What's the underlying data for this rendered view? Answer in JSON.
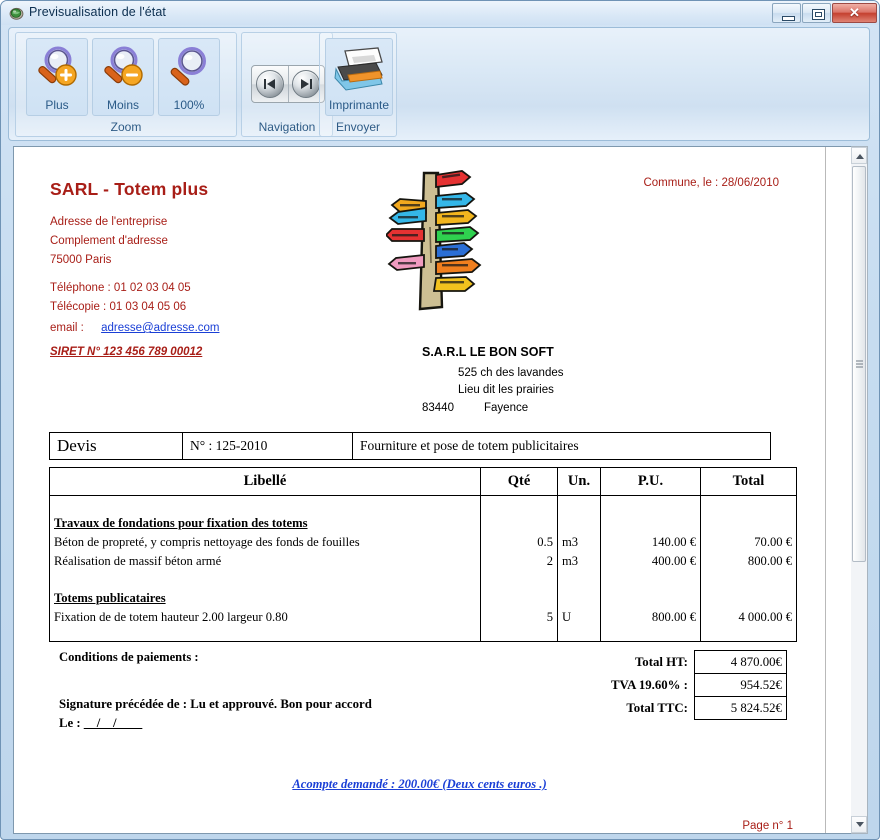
{
  "window": {
    "title": "Previsualisation de l'état",
    "icon": "preview-globe-icon",
    "buttons": {
      "minimize": "minimize-icon",
      "restore": "restore-icon",
      "close": "✕"
    }
  },
  "ribbon": {
    "groups": [
      {
        "name": "Zoom",
        "label": "Zoom",
        "buttons": [
          {
            "label": "Plus",
            "icon": "zoom-in-icon"
          },
          {
            "label": "Moins",
            "icon": "zoom-out-icon"
          },
          {
            "label": "100%",
            "icon": "zoom-100-icon"
          }
        ]
      },
      {
        "name": "Navigation",
        "label": "Navigation",
        "buttons": [
          {
            "label": "",
            "icon": "previous-page-icon"
          },
          {
            "label": "",
            "icon": "next-page-icon"
          }
        ]
      },
      {
        "name": "Envoyer",
        "label": "Envoyer",
        "buttons": [
          {
            "label": "Imprimante",
            "icon": "printer-icon"
          }
        ]
      }
    ]
  },
  "document": {
    "sender": {
      "company": "SARL - Totem plus",
      "address1": "Adresse de l'entreprise",
      "address2": "Complement d'adresse",
      "city": "75000  Paris",
      "phone": "Téléphone : 01 02 03 04 05",
      "fax": "Télécopie   : 01 03 04 05 06",
      "email_label": "email :",
      "email": "adresse@adresse.com",
      "siret": "SIRET N° 123 456 789 00012"
    },
    "date_line": "Commune, le :  28/06/2010",
    "logo": "totem-signpost-image",
    "client": {
      "name": "S.A.R.L LE BON SOFT",
      "address1": "525 ch des lavandes",
      "address2": "Lieu dit les prairies",
      "postcode": "83440",
      "city": "Fayence"
    },
    "doc_header": {
      "type": "Devis",
      "number": "N° : 125-2010",
      "subject": "Fourniture et pose de totem publicitaires"
    },
    "table": {
      "columns": [
        "Libellé",
        "Qté",
        "Un.",
        "P.U.",
        "Total"
      ],
      "rows": [
        {
          "kind": "section",
          "label": "Travaux de fondations pour fixation des totems",
          "qty": "",
          "unit": "",
          "pu": "",
          "total": ""
        },
        {
          "kind": "item",
          "label": "Béton de propreté, y compris nettoyage des fonds de fouilles",
          "qty": "0.5",
          "unit": "m3",
          "pu": "140.00 €",
          "total": "70.00 €"
        },
        {
          "kind": "item",
          "label": "Réalisation de massif béton armé",
          "qty": "2",
          "unit": "m3",
          "pu": "400.00 €",
          "total": "800.00 €"
        },
        {
          "kind": "blank",
          "label": "",
          "qty": "",
          "unit": "",
          "pu": "",
          "total": ""
        },
        {
          "kind": "section",
          "label": "Totems publicataires",
          "qty": "",
          "unit": "",
          "pu": "",
          "total": ""
        },
        {
          "kind": "item",
          "label": "Fixation de de totem hauteur 2.00 largeur 0.80",
          "qty": "5",
          "unit": "U",
          "pu": "800.00 €",
          "total": "4 000.00 €"
        }
      ]
    },
    "conditions_label": "Conditions de paiements :",
    "signature_text": "Signature précédée de : Lu et approuvé. Bon pour accord",
    "date_blank": "Le :",
    "date_blank_fields": "__/__/____",
    "totals": [
      {
        "label": "Total HT:",
        "value": "4 870.00€"
      },
      {
        "label": "TVA 19.60% :",
        "value": "954.52€"
      },
      {
        "label": "Total TTC:",
        "value": "5 824.52€"
      }
    ],
    "acompte": "Acompte demandé :   200.00€ (Deux cents euros .)",
    "page_number": "Page n°  1"
  },
  "colors": {
    "sender_red": "#a81e17",
    "link_blue": "#1a3fd6",
    "ribbon_label": "#2e5b86"
  }
}
